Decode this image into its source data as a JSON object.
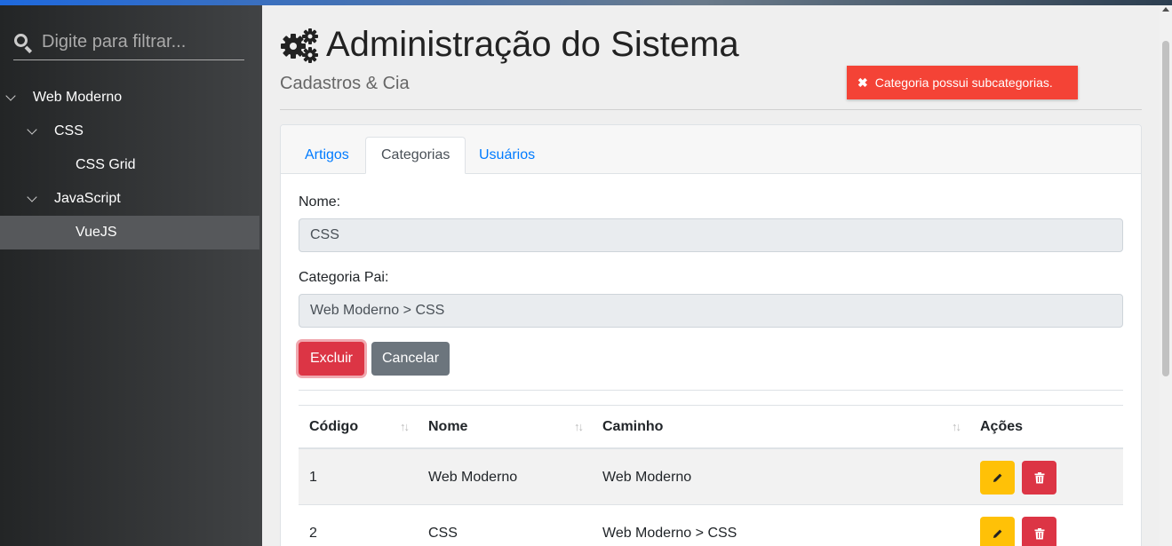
{
  "sidebar": {
    "search_placeholder": "Digite para filtrar...",
    "tree": [
      {
        "label": "Web Moderno",
        "level": 0,
        "expanded": true
      },
      {
        "label": "CSS",
        "level": 1,
        "expanded": true
      },
      {
        "label": "CSS Grid",
        "level": 2
      },
      {
        "label": "JavaScript",
        "level": 1,
        "expanded": true
      },
      {
        "label": "VueJS",
        "level": 2,
        "selected": true
      }
    ]
  },
  "header": {
    "title": "Administração do Sistema",
    "subtitle": "Cadastros & Cia",
    "title_icon": "cogs-icon"
  },
  "toast": {
    "icon": "close-icon",
    "message": "Categoria possui subcategorias.",
    "color": "#f44336"
  },
  "tabs": [
    {
      "label": "Artigos",
      "active": false
    },
    {
      "label": "Categorias",
      "active": true
    },
    {
      "label": "Usuários",
      "active": false
    }
  ],
  "form": {
    "name_label": "Nome:",
    "name_value": "CSS",
    "parent_label": "Categoria Pai:",
    "parent_value": "Web Moderno > CSS",
    "delete_label": "Excluir",
    "cancel_label": "Cancelar"
  },
  "table": {
    "headers": [
      "Código",
      "Nome",
      "Caminho",
      "Ações"
    ],
    "rows": [
      {
        "id": "1",
        "name": "Web Moderno",
        "path": "Web Moderno"
      },
      {
        "id": "2",
        "name": "CSS",
        "path": "Web Moderno > CSS"
      }
    ]
  },
  "colors": {
    "danger": "#dc3545",
    "warning": "#ffc107",
    "secondary": "#6c757d",
    "link": "#007bff"
  }
}
